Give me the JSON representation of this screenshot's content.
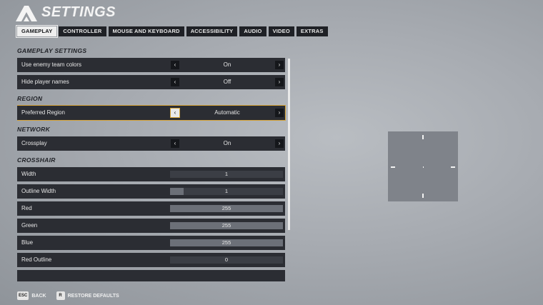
{
  "header": {
    "title": "SETTINGS"
  },
  "tabs": [
    {
      "label": "GAMEPLAY",
      "active": true
    },
    {
      "label": "CONTROLLER"
    },
    {
      "label": "MOUSE AND KEYBOARD"
    },
    {
      "label": "ACCESSIBILITY"
    },
    {
      "label": "AUDIO"
    },
    {
      "label": "VIDEO"
    },
    {
      "label": "EXTRAS"
    }
  ],
  "sections": {
    "gameplay": "GAMEPLAY SETTINGS",
    "region": "REGION",
    "network": "NETWORK",
    "crosshair": "CROSSHAIR"
  },
  "settings": {
    "enemy_colors": {
      "label": "Use enemy team colors",
      "value": "On"
    },
    "hide_names": {
      "label": "Hide player names",
      "value": "Off"
    },
    "region": {
      "label": "Preferred Region",
      "value": "Automatic"
    },
    "crossplay": {
      "label": "Crossplay",
      "value": "On"
    },
    "width": {
      "label": "Width",
      "value": "1",
      "level": 0.0
    },
    "outline_width": {
      "label": "Outline Width",
      "value": "1",
      "level": 0.12
    },
    "red": {
      "label": "Red",
      "value": "255",
      "level": 1.0
    },
    "green": {
      "label": "Green",
      "value": "255",
      "level": 1.0
    },
    "blue": {
      "label": "Blue",
      "value": "255",
      "level": 1.0
    },
    "red_outline": {
      "label": "Red Outline",
      "value": "0",
      "level": 0.0
    }
  },
  "footer": {
    "back_key": "ESC",
    "back_label": "BACK",
    "restore_key": "R",
    "restore_label": "RESTORE DEFAULTS"
  },
  "colors": {
    "accent": "#d7a53a",
    "row_bg": "#2b2d33",
    "active_tab": "#eeeeee"
  }
}
